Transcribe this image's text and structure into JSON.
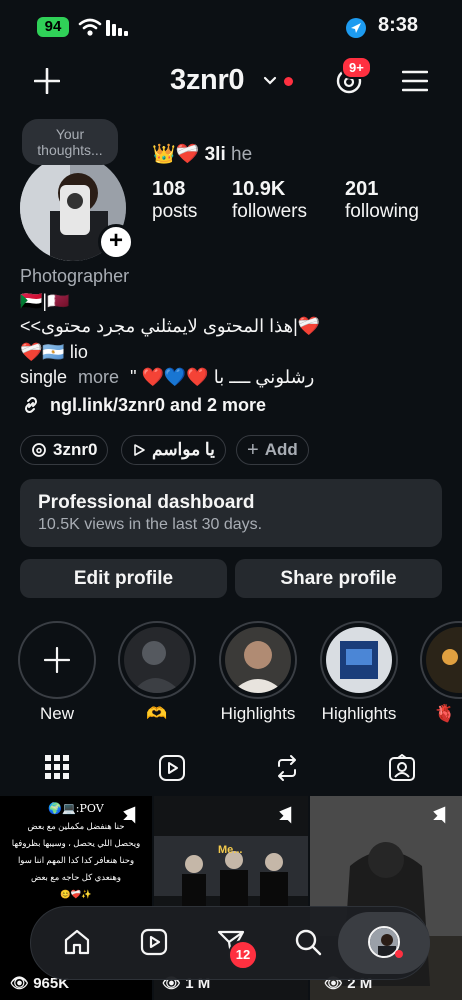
{
  "status_bar": {
    "battery": "94",
    "time": "8:38"
  },
  "header": {
    "username": "3znr0",
    "notification_count": "9+"
  },
  "profile": {
    "thoughts_placeholder": "Your thoughts...",
    "name_emoji": "👑❤️‍🩹",
    "display_name": "3li",
    "pronouns": "he",
    "stats": [
      {
        "value": "108",
        "label": "posts"
      },
      {
        "value": "10.9K",
        "label": "followers"
      },
      {
        "value": "201",
        "label": "following"
      }
    ],
    "category": "Photographer",
    "bio_line1": "🇸🇩|🇶🇦",
    "bio_line2": "❤️‍🩹|هذا المحتوى لايمثلني مجرد محتوى>>",
    "bio_line3": "❤️‍🩹🇦🇷 lio",
    "bio_line4_start": "single",
    "bio_more": "more",
    "bio_line4_end": "\" ❤️💙❤️ رشلوني ــــ با",
    "link_text": "ngl.link/3znr0 and 2 more"
  },
  "pills": {
    "threads": "3znr0",
    "music": "يا مواسم",
    "add": "Add"
  },
  "dashboard": {
    "title": "Professional dashboard",
    "subtitle": "10.5K views in the last 30 days."
  },
  "buttons": {
    "edit": "Edit profile",
    "share": "Share profile"
  },
  "highlights": [
    {
      "label": "New"
    },
    {
      "label": "🫶"
    },
    {
      "label": "Highlights"
    },
    {
      "label": "Highlights"
    },
    {
      "label": "🫀"
    }
  ],
  "grid": {
    "posts": [
      {
        "views": "965K",
        "header": "POV:💻🌍",
        "lines": [
          "حنا هنفضل مكملين مع بعض",
          "ويحصل اللي يحصل ، وسيبها بظروفها",
          "وحنا هنعافر كدا كدا المهم اننا سوا",
          "وهنعدي كل حاجه مع بعض",
          "✨❤️‍🩹😊"
        ]
      },
      {
        "views": "1 M",
        "caption": "Me..."
      },
      {
        "views": "2 M"
      }
    ]
  },
  "nav": {
    "messages_badge": "12"
  }
}
